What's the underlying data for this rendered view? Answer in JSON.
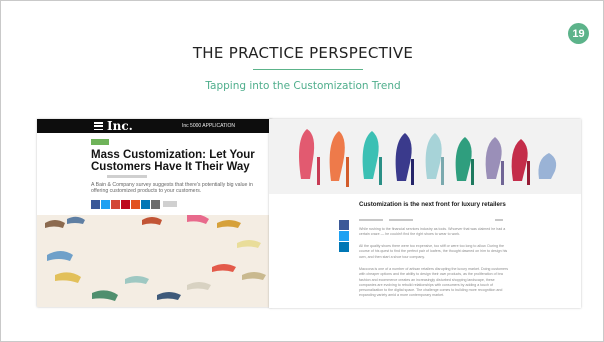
{
  "slide": {
    "page_number": "19",
    "title": "THE PRACTICE PERSPECTIVE",
    "subtitle": "Tapping into the Customization Trend"
  },
  "left_article": {
    "site_logo": "Inc.",
    "header_right_text": "Inc 5000 APPLICATION",
    "title": "Mass Customization: Let Your Customers Have It Their Way",
    "dek": "A Bain & Company survey suggests that there's potentially big value in offering customized products to your customers.",
    "share_colors": [
      "#3b5998",
      "#1da1f2",
      "#d34836",
      "#bd081c",
      "#e2531f",
      "#0077b5",
      "#6b6b6b"
    ]
  },
  "right_article": {
    "title": "Customization is the next front for luxury retailers",
    "paragraphs": [
      "While rushing to the financial services industry as tools. Whoever that was claimed he had a certain craze — he couldn't find the right shoes to wear to work.",
      "All the quality shoes there were too expensive, too stiff or were too long to allow. During the course of his quest to find the perfect pair of loafers, the thought dawned on him to design his own, and then start a shoe tour company.",
      "Maccona is one of a number of artisan retailers disrupting the luxury market. Doing customers with cheaper options and the ability to design their own products, as the proliferation of bra fashion and ecommerce creates an increasingly disturbed shopping landscape, these companies are evolving to rebuild relationships with consumers by adding a touch of personalization to the digital space. The challenge comes to building more recognition and expanding variety amid a more contemporary market."
    ],
    "side_icon_colors": [
      "#3b5998",
      "#1da1f2",
      "#0077b5"
    ]
  }
}
